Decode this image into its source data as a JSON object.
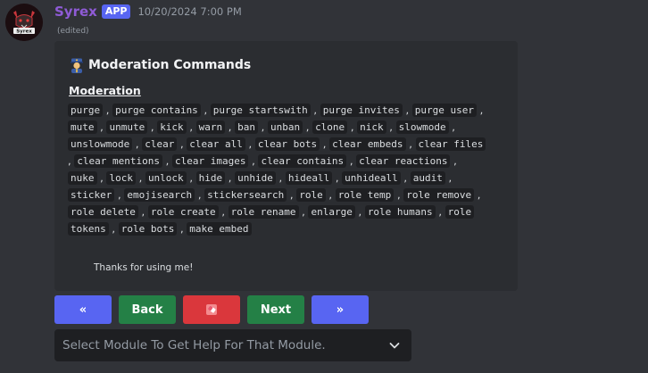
{
  "message": {
    "username": "Syrex",
    "badge": "APP",
    "timestamp": "10/20/2024 7:00 PM",
    "edited": "(edited)",
    "avatar": {
      "icon": "wolf-avatar-icon",
      "text": "Syrex"
    }
  },
  "embed": {
    "title": "Moderation Commands",
    "title_icon": "police-officer-icon",
    "section": "Moderation",
    "lines": [
      {
        "lead": "",
        "cmds": [
          "purge",
          "purge contains",
          "purge startswith",
          "purge invites",
          "purge user"
        ],
        "trail": ","
      },
      {
        "lead": "",
        "cmds": [
          "mute",
          "unmute",
          "kick",
          "warn",
          "ban",
          "unban",
          "clone",
          "nick",
          "slowmode"
        ],
        "trail": ","
      },
      {
        "lead": "",
        "cmds": [
          "unslowmode",
          "clear",
          "clear all",
          "clear bots",
          "clear embeds",
          "clear files"
        ],
        "trail": ""
      },
      {
        "lead": ",",
        "cmds": [
          "clear mentions",
          "clear images",
          "clear contains",
          "clear reactions"
        ],
        "trail": ","
      },
      {
        "lead": "",
        "cmds": [
          "nuke",
          "lock",
          "unlock",
          "hide",
          "unhide",
          "hideall",
          "unhideall",
          "audit"
        ],
        "trail": ","
      },
      {
        "lead": "",
        "cmds": [
          "sticker",
          "emojisearch",
          "stickersearch",
          "role",
          "role temp",
          "role remove"
        ],
        "trail": ","
      },
      {
        "lead": "",
        "cmds": [
          "role delete",
          "role create",
          "role rename",
          "enlarge",
          "role humans",
          "role "
        ],
        "trail": ""
      },
      {
        "lead": "",
        "cmds": [
          "tokens",
          "role bots",
          "make embed"
        ],
        "trail": ""
      }
    ],
    "footer": "Thanks for using me!"
  },
  "buttons": [
    {
      "name": "first-page-button",
      "label": "«",
      "color": "#5865f2"
    },
    {
      "name": "back-button",
      "label": "Back",
      "color": "#248046"
    },
    {
      "name": "delete-button",
      "label": "",
      "icon": "eraser-icon",
      "color": "#da373c"
    },
    {
      "name": "next-button",
      "label": "Next",
      "color": "#248046"
    },
    {
      "name": "last-page-button",
      "label": "»",
      "color": "#5865f2"
    }
  ],
  "select": {
    "placeholder": "Select Module To Get Help For That Module.",
    "icon": "chevron-down-icon"
  }
}
